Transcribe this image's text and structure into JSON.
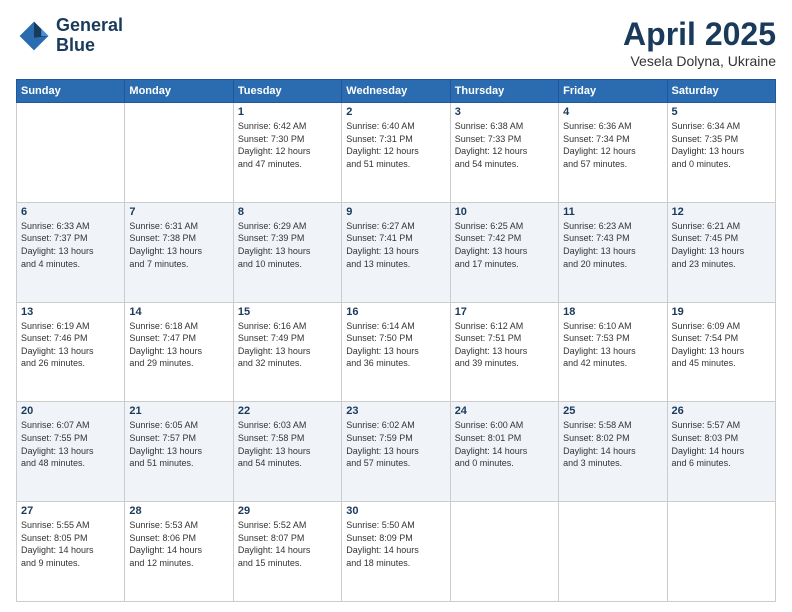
{
  "logo": {
    "line1": "General",
    "line2": "Blue"
  },
  "title": "April 2025",
  "subtitle": "Vesela Dolyna, Ukraine",
  "weekdays": [
    "Sunday",
    "Monday",
    "Tuesday",
    "Wednesday",
    "Thursday",
    "Friday",
    "Saturday"
  ],
  "weeks": [
    [
      {
        "day": "",
        "info": ""
      },
      {
        "day": "",
        "info": ""
      },
      {
        "day": "1",
        "info": "Sunrise: 6:42 AM\nSunset: 7:30 PM\nDaylight: 12 hours\nand 47 minutes."
      },
      {
        "day": "2",
        "info": "Sunrise: 6:40 AM\nSunset: 7:31 PM\nDaylight: 12 hours\nand 51 minutes."
      },
      {
        "day": "3",
        "info": "Sunrise: 6:38 AM\nSunset: 7:33 PM\nDaylight: 12 hours\nand 54 minutes."
      },
      {
        "day": "4",
        "info": "Sunrise: 6:36 AM\nSunset: 7:34 PM\nDaylight: 12 hours\nand 57 minutes."
      },
      {
        "day": "5",
        "info": "Sunrise: 6:34 AM\nSunset: 7:35 PM\nDaylight: 13 hours\nand 0 minutes."
      }
    ],
    [
      {
        "day": "6",
        "info": "Sunrise: 6:33 AM\nSunset: 7:37 PM\nDaylight: 13 hours\nand 4 minutes."
      },
      {
        "day": "7",
        "info": "Sunrise: 6:31 AM\nSunset: 7:38 PM\nDaylight: 13 hours\nand 7 minutes."
      },
      {
        "day": "8",
        "info": "Sunrise: 6:29 AM\nSunset: 7:39 PM\nDaylight: 13 hours\nand 10 minutes."
      },
      {
        "day": "9",
        "info": "Sunrise: 6:27 AM\nSunset: 7:41 PM\nDaylight: 13 hours\nand 13 minutes."
      },
      {
        "day": "10",
        "info": "Sunrise: 6:25 AM\nSunset: 7:42 PM\nDaylight: 13 hours\nand 17 minutes."
      },
      {
        "day": "11",
        "info": "Sunrise: 6:23 AM\nSunset: 7:43 PM\nDaylight: 13 hours\nand 20 minutes."
      },
      {
        "day": "12",
        "info": "Sunrise: 6:21 AM\nSunset: 7:45 PM\nDaylight: 13 hours\nand 23 minutes."
      }
    ],
    [
      {
        "day": "13",
        "info": "Sunrise: 6:19 AM\nSunset: 7:46 PM\nDaylight: 13 hours\nand 26 minutes."
      },
      {
        "day": "14",
        "info": "Sunrise: 6:18 AM\nSunset: 7:47 PM\nDaylight: 13 hours\nand 29 minutes."
      },
      {
        "day": "15",
        "info": "Sunrise: 6:16 AM\nSunset: 7:49 PM\nDaylight: 13 hours\nand 32 minutes."
      },
      {
        "day": "16",
        "info": "Sunrise: 6:14 AM\nSunset: 7:50 PM\nDaylight: 13 hours\nand 36 minutes."
      },
      {
        "day": "17",
        "info": "Sunrise: 6:12 AM\nSunset: 7:51 PM\nDaylight: 13 hours\nand 39 minutes."
      },
      {
        "day": "18",
        "info": "Sunrise: 6:10 AM\nSunset: 7:53 PM\nDaylight: 13 hours\nand 42 minutes."
      },
      {
        "day": "19",
        "info": "Sunrise: 6:09 AM\nSunset: 7:54 PM\nDaylight: 13 hours\nand 45 minutes."
      }
    ],
    [
      {
        "day": "20",
        "info": "Sunrise: 6:07 AM\nSunset: 7:55 PM\nDaylight: 13 hours\nand 48 minutes."
      },
      {
        "day": "21",
        "info": "Sunrise: 6:05 AM\nSunset: 7:57 PM\nDaylight: 13 hours\nand 51 minutes."
      },
      {
        "day": "22",
        "info": "Sunrise: 6:03 AM\nSunset: 7:58 PM\nDaylight: 13 hours\nand 54 minutes."
      },
      {
        "day": "23",
        "info": "Sunrise: 6:02 AM\nSunset: 7:59 PM\nDaylight: 13 hours\nand 57 minutes."
      },
      {
        "day": "24",
        "info": "Sunrise: 6:00 AM\nSunset: 8:01 PM\nDaylight: 14 hours\nand 0 minutes."
      },
      {
        "day": "25",
        "info": "Sunrise: 5:58 AM\nSunset: 8:02 PM\nDaylight: 14 hours\nand 3 minutes."
      },
      {
        "day": "26",
        "info": "Sunrise: 5:57 AM\nSunset: 8:03 PM\nDaylight: 14 hours\nand 6 minutes."
      }
    ],
    [
      {
        "day": "27",
        "info": "Sunrise: 5:55 AM\nSunset: 8:05 PM\nDaylight: 14 hours\nand 9 minutes."
      },
      {
        "day": "28",
        "info": "Sunrise: 5:53 AM\nSunset: 8:06 PM\nDaylight: 14 hours\nand 12 minutes."
      },
      {
        "day": "29",
        "info": "Sunrise: 5:52 AM\nSunset: 8:07 PM\nDaylight: 14 hours\nand 15 minutes."
      },
      {
        "day": "30",
        "info": "Sunrise: 5:50 AM\nSunset: 8:09 PM\nDaylight: 14 hours\nand 18 minutes."
      },
      {
        "day": "",
        "info": ""
      },
      {
        "day": "",
        "info": ""
      },
      {
        "day": "",
        "info": ""
      }
    ]
  ]
}
